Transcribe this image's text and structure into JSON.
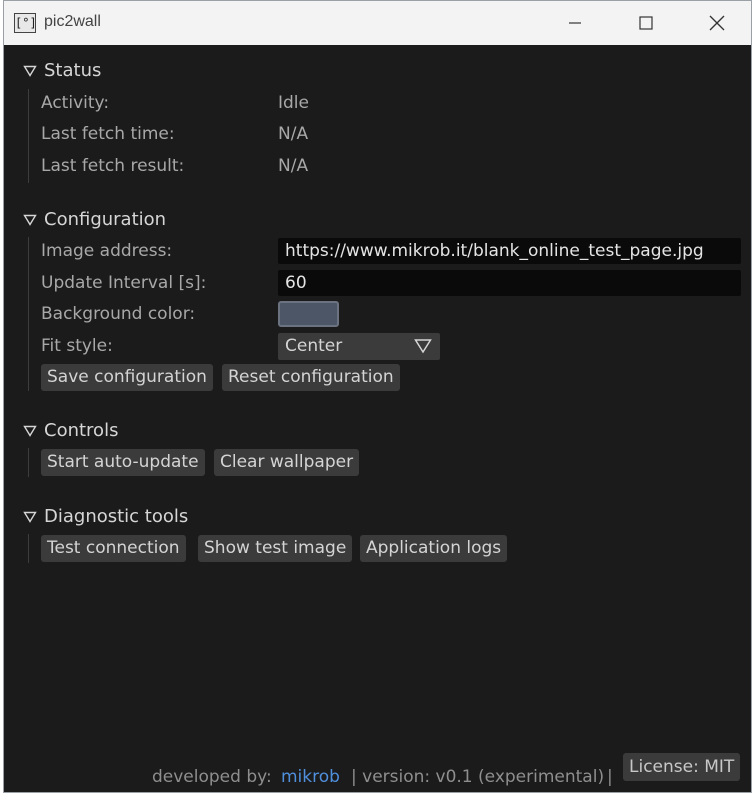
{
  "window": {
    "title": "pic2wall",
    "icon_text": "[°]",
    "controls": [
      "minimize-icon",
      "maximize-icon",
      "close-icon"
    ]
  },
  "status": {
    "header": "Status",
    "rows": [
      {
        "label": "Activity:",
        "value": "Idle"
      },
      {
        "label": "Last fetch time:",
        "value": "N/A"
      },
      {
        "label": "Last fetch result:",
        "value": "N/A"
      }
    ]
  },
  "configuration": {
    "header": "Configuration",
    "image_address_label": "Image address:",
    "image_address_value": "https://www.mikrob.it/blank_online_test_page.jpg",
    "update_interval_label": "Update Interval [s]:",
    "update_interval_value": "60",
    "background_color_label": "Background color:",
    "background_color_value": "#4d5666",
    "fit_style_label": "Fit style:",
    "fit_style_value": "Center",
    "save_button": "Save configuration",
    "reset_button": "Reset configuration"
  },
  "controls": {
    "header": "Controls",
    "start_button": "Start auto-update",
    "clear_button": "Clear wallpaper"
  },
  "diagnostics": {
    "header": "Diagnostic tools",
    "test_connection_button": "Test connection",
    "show_test_image_button": "Show test image",
    "application_logs_button": "Application logs"
  },
  "footer": {
    "developed_by": "developed by:",
    "author": "mikrob",
    "version_text": "| version: v0.1 (experimental)",
    "separator": "|",
    "license_button": "License: MIT"
  },
  "colors": {
    "background": "#1b1b1b",
    "titlebar": "#f3f3f3",
    "button": "#3b3b3b",
    "input": "#0a0a0a",
    "link": "#4f8fdc"
  }
}
